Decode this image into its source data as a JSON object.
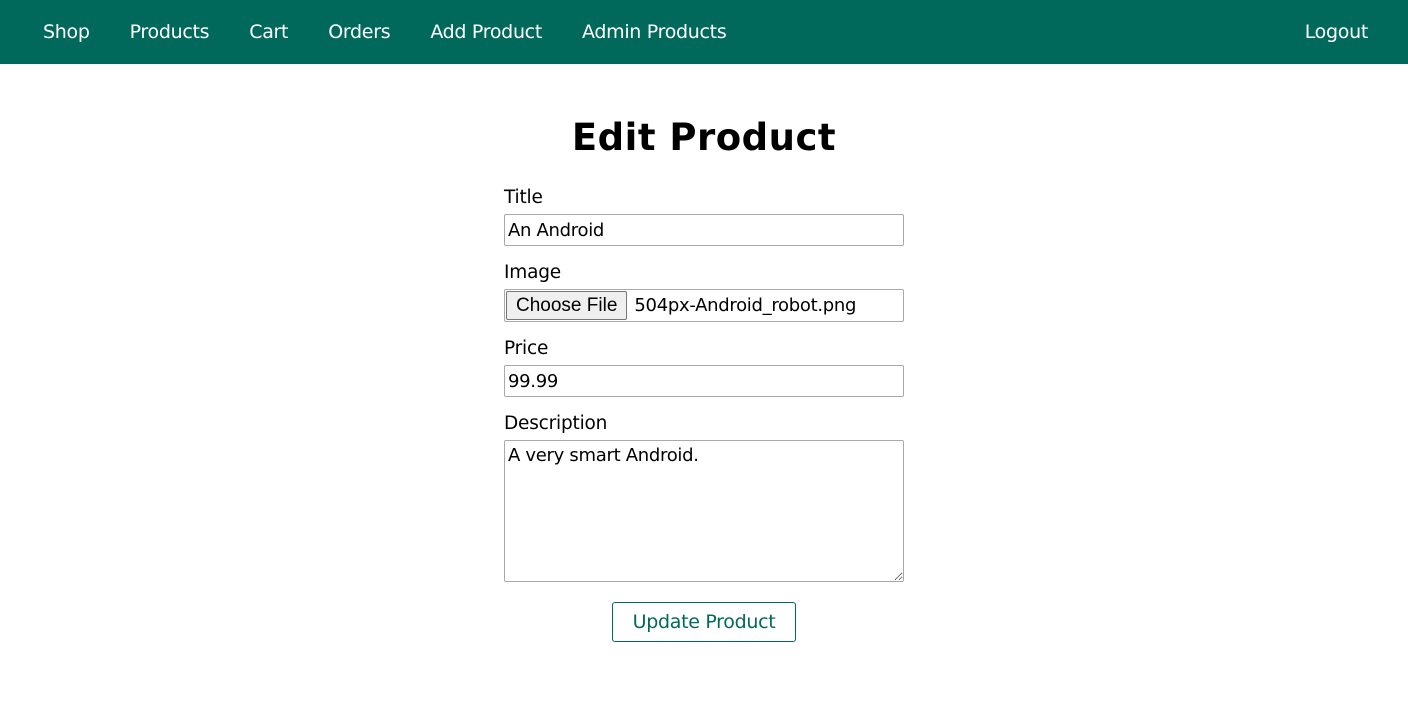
{
  "header": {
    "nav_items": [
      {
        "label": "Shop"
      },
      {
        "label": "Products"
      },
      {
        "label": "Cart"
      },
      {
        "label": "Orders"
      },
      {
        "label": "Add Product"
      },
      {
        "label": "Admin Products"
      }
    ],
    "logout_label": "Logout",
    "background_color": "#00695c"
  },
  "main": {
    "title": "Edit Product",
    "form": {
      "title_label": "Title",
      "title_value": "An Android",
      "image_label": "Image",
      "choose_file_label": "Choose File",
      "file_name": "504px-Android_robot.png",
      "price_label": "Price",
      "price_value": "99.99",
      "description_label": "Description",
      "description_value": "A very smart Android.",
      "submit_label": "Update Product"
    }
  }
}
